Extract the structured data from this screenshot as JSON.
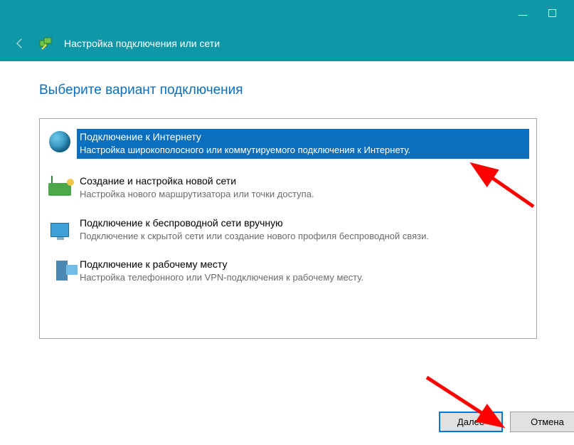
{
  "window": {
    "title": "Настройка подключения или сети"
  },
  "page": {
    "heading": "Выберите вариант подключения"
  },
  "options": [
    {
      "title": "Подключение к Интернету",
      "desc": "Настройка широкополосного или коммутируемого подключения к Интернету.",
      "selected": true
    },
    {
      "title": "Создание и настройка новой сети",
      "desc": "Настройка нового маршрутизатора или точки доступа.",
      "selected": false
    },
    {
      "title": "Подключение к беспроводной сети вручную",
      "desc": "Подключение к скрытой сети или создание нового профиля беспроводной связи.",
      "selected": false
    },
    {
      "title": "Подключение к рабочему месту",
      "desc": "Настройка телефонного или VPN-подключения к рабочему месту.",
      "selected": false
    }
  ],
  "buttons": {
    "next": "Далее",
    "cancel": "Отмена"
  }
}
